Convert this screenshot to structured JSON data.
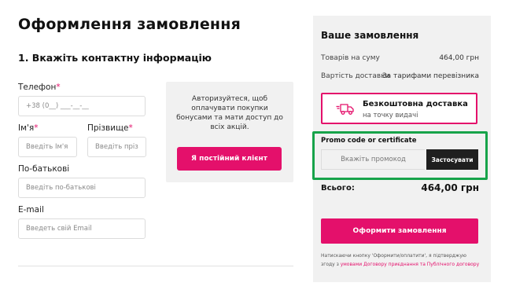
{
  "page": {
    "title": "Оформлення замовлення"
  },
  "contact": {
    "section_title": "1. Вкажіть контактну інформацію",
    "phone": {
      "label": "Телефон",
      "placeholder": "+38 (0__) ___-__-__"
    },
    "first_name": {
      "label": "Ім'я",
      "placeholder": "Введіть Ім'я"
    },
    "last_name": {
      "label": "Прізвище",
      "placeholder": "Введіть прізв"
    },
    "patronymic": {
      "label": "По-батькові",
      "placeholder": "Введіть по-батькові"
    },
    "email": {
      "label": "E-mail",
      "placeholder": "Введеть свій Email"
    }
  },
  "auth": {
    "text": "Авторизуйтеся, щоб оплачувати покупки бонусами та мати доступ до всіх акцій.",
    "button": "Я постійний клієнт"
  },
  "summary": {
    "title": "Ваше замовлення",
    "goods_label": "Товарів на суму",
    "goods_value": "464,00 грн",
    "delivery_label": "Вартість доставки",
    "delivery_value": "За тарифами перевізника",
    "free_delivery_title": "Безкоштовна доставка",
    "free_delivery_sub": "на точку видачі",
    "free_delivery_icon": "truck-icon",
    "promo_label": "Promo code or certificate",
    "promo_placeholder": "Вкажіть промокод",
    "promo_button": "Застосувати",
    "total_label": "Всього:",
    "total_value": "464,00 грн",
    "order_button": "Оформити замовлення",
    "legal_text": "Натискаючи кнопку 'Оформити/оплатити', я підтверджую згоду з",
    "legal_link": "умовами Договору приєднання та Публічного договору"
  },
  "colors": {
    "accent": "#e4106b",
    "highlight": "#17a34a",
    "panel": "#f1f1f1",
    "dark_button": "#1f1f1f"
  }
}
